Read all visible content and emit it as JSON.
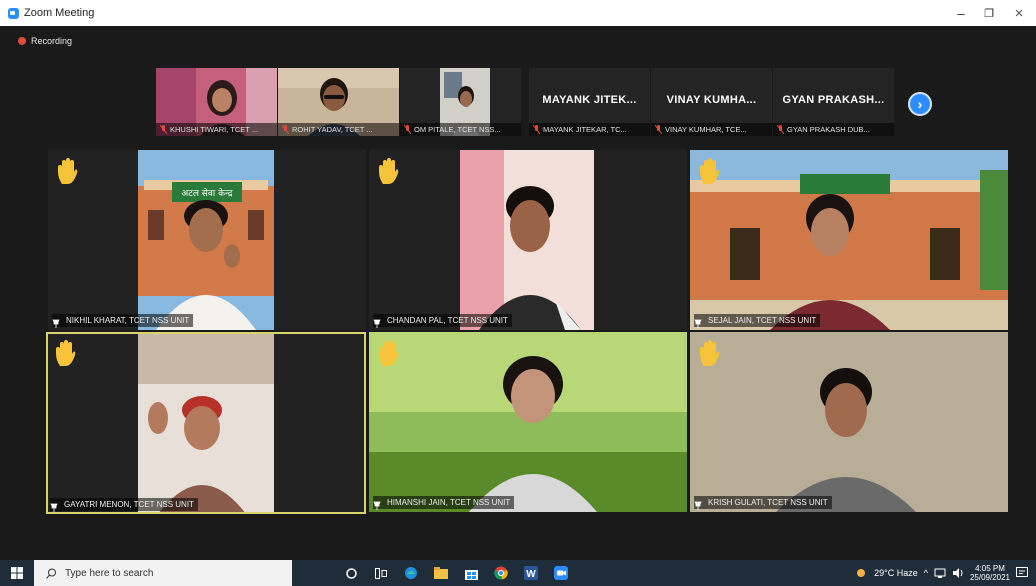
{
  "window": {
    "title": "Zoom Meeting",
    "minimize": "–",
    "restore": "❐",
    "close": "×"
  },
  "recording": {
    "label": "Recording",
    "color": "#e04a3a"
  },
  "strip": {
    "tiles": [
      {
        "label": "KHUSHI TIWARI, TCET ..."
      },
      {
        "label": "ROHIT YADAV, TCET ..."
      },
      {
        "label": "OM PITALE, TCET NSS..."
      },
      {
        "big_name": "MAYANK JITEK...",
        "label": "MAYANK JITEKAR, TC..."
      },
      {
        "big_name": "VINAY KUMHA...",
        "label": "VINAY KUMHAR, TCE..."
      },
      {
        "big_name": "GYAN PRAKASH...",
        "label": "GYAN PRAKASH DUB..."
      }
    ],
    "next_icon": "chevron-right-icon"
  },
  "gallery": [
    {
      "label": "NIKHIL KHARAT, TCET NSS UNIT"
    },
    {
      "label": "CHANDAN PAL, TCET NSS UNIT"
    },
    {
      "label": "SEJAL JAIN, TCET NSS UNIT"
    },
    {
      "label": "GAYATRI MENON, TCET NSS UNIT"
    },
    {
      "label": "HIMANSHI JAIN, TCET NSS UNIT"
    },
    {
      "label": "KRISH GULATI, TCET NSS UNIT"
    }
  ],
  "signboard": {
    "text": "अटल सेवा केन्द्र"
  },
  "taskbar": {
    "search_placeholder": "Type here to search",
    "weather": "29°C  Haze",
    "time": "4:05 PM",
    "date": "25/09/2021"
  },
  "colors": {
    "accent": "#2d8cff",
    "hand": "#f6c33a",
    "active_border": "#d8d36a"
  }
}
